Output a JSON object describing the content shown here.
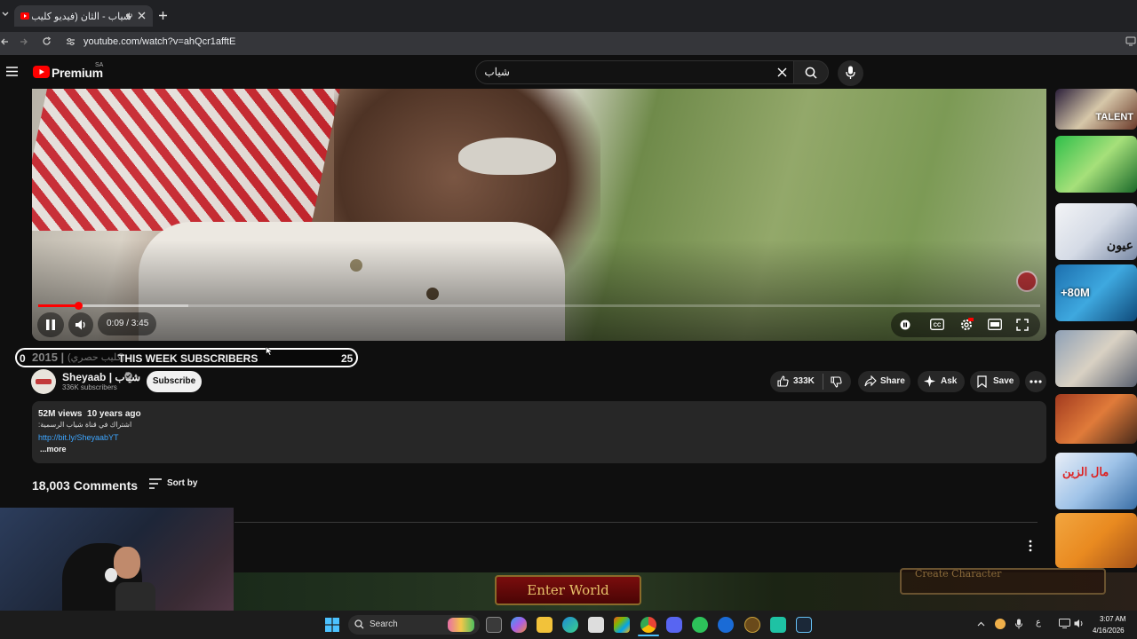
{
  "browser": {
    "tab_title": "شياب - الثان (فيديو كليب حد...",
    "url": "youtube.com/watch?v=ahQcr1afftE"
  },
  "header": {
    "logo_text": "Premium",
    "country": "SA",
    "search_value": "شياب"
  },
  "player": {
    "time": "0:09 / 3:45",
    "progress_fraction": 0.04,
    "buffer_fraction": 0.15
  },
  "overlay": {
    "left_count": "0",
    "label": "THIS WEEK SUBSCRIBERS",
    "right_count": "25",
    "title_year": "2015 |",
    "title_text": "(كليب حصري)"
  },
  "channel": {
    "name": "Sheyaab | شياب",
    "subscribers": "336K subscribers",
    "subscribe_label": "Subscribe"
  },
  "actions": {
    "likes": "333K",
    "share": "Share",
    "ask": "Ask",
    "save": "Save"
  },
  "description": {
    "views_line": "52M views  10 years ago",
    "line1": "اشتراك في قناة شياب الرسمية:",
    "link": "http://bit.ly/SheyaabYT",
    "more": "...more"
  },
  "comments": {
    "count": "18,003 Comments",
    "sort_label": "Sort by"
  },
  "sidebar": {
    "thumbs": [
      {
        "label": "TALENT"
      },
      {
        "label": ""
      },
      {
        "label": "عيون"
      },
      {
        "label": "+80M"
      },
      {
        "label": ""
      },
      {
        "label": ""
      },
      {
        "label": "مال الزين"
      },
      {
        "label": ""
      }
    ]
  },
  "game": {
    "enter_world": "Enter World",
    "create_character": "Create Character"
  },
  "taskbar": {
    "search_label": "Search",
    "time": "3:07 AM",
    "date": "4/16/2026"
  },
  "colors": {
    "yt_red": "#ff0000",
    "link_blue": "#3ea6ff",
    "background": "#0f0f0f"
  }
}
